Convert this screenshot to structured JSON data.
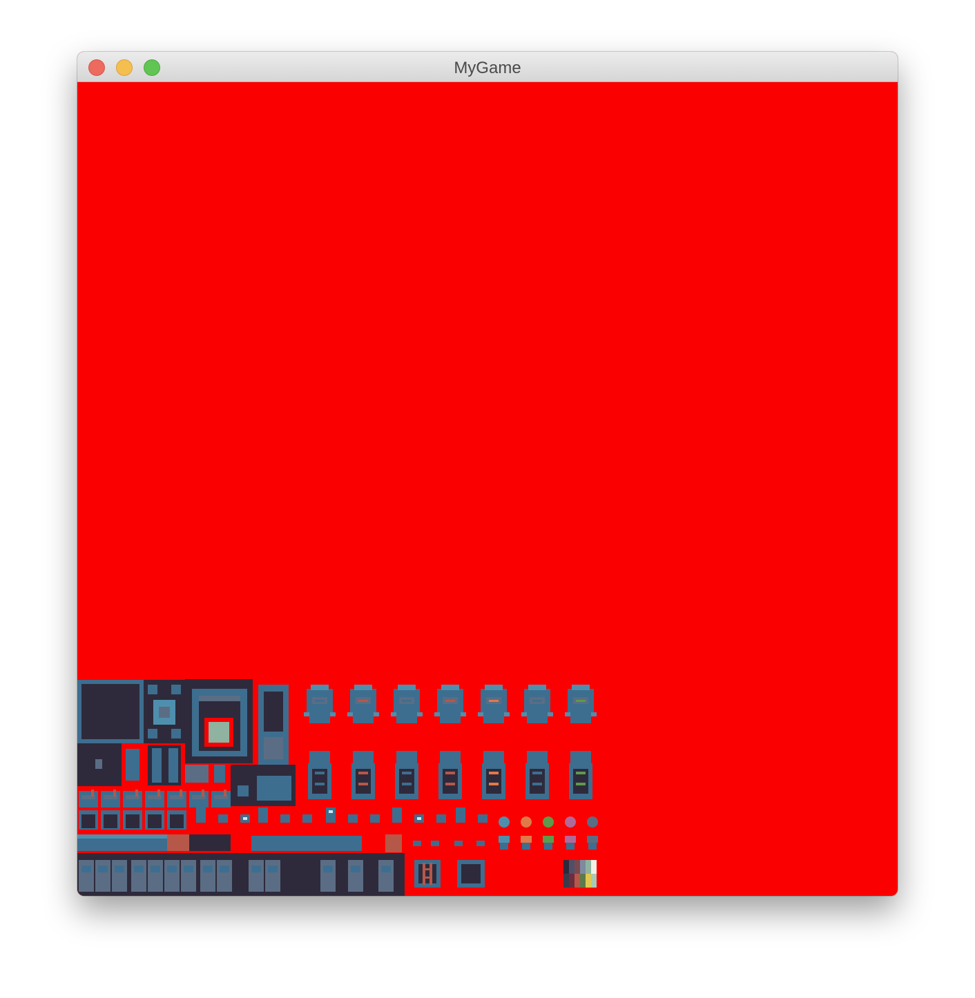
{
  "window": {
    "title": "MyGame",
    "controls": {
      "close": "close-button",
      "minimize": "minimize-button",
      "zoom": "zoom-button"
    }
  },
  "canvas": {
    "background_color": "#fb0000",
    "content": "tileset-spritesheet"
  },
  "palette": {
    "dark": "#2e2a3b",
    "stone": "#3d6e8f",
    "stone_light": "#4f8fae",
    "stone_mid": "#5b6d84",
    "glass": "#8fb3a0",
    "wood": "#b5584a",
    "swatches": [
      "#2e2a3b",
      "#514e6a",
      "#7a4950",
      "#b5584a",
      "#7e8aa0",
      "#8fb3a0",
      "#a7c9b6",
      "#f2f0e6",
      "#3a3a4c",
      "#6d2d3d",
      "#5e7a4c",
      "#e0c850"
    ]
  }
}
